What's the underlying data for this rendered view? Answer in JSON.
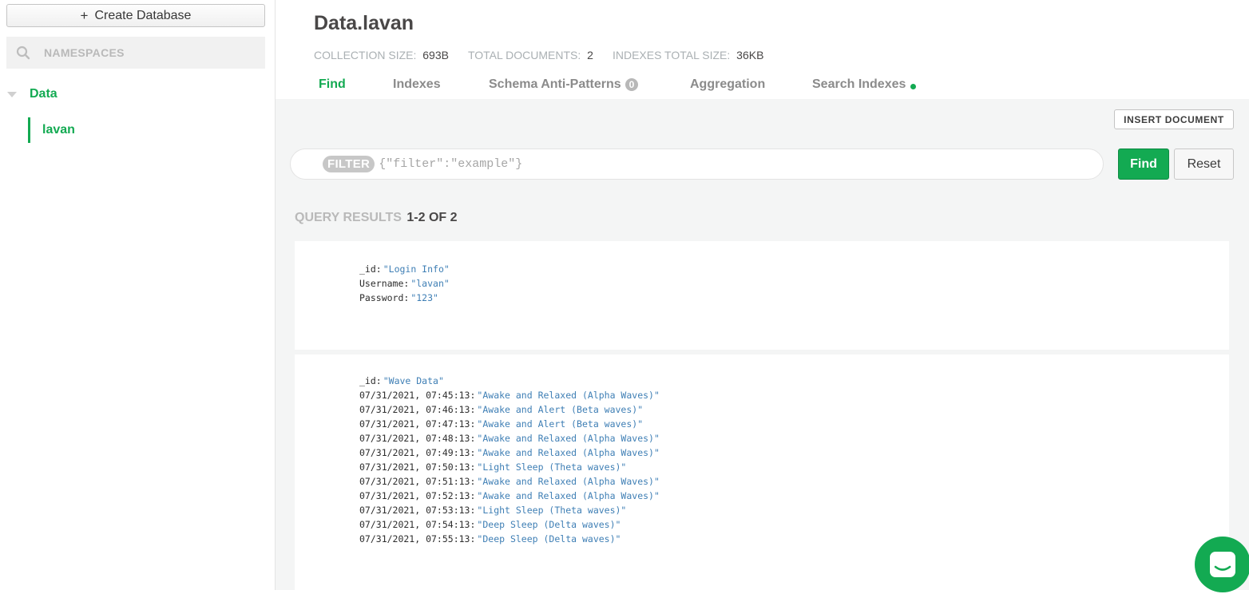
{
  "sidebar": {
    "create_database_label": "Create Database",
    "namespace_search_placeholder": "NAMESPACES",
    "database_name": "Data",
    "collection_name": "lavan"
  },
  "header": {
    "title": "Data.lavan",
    "stats": {
      "collection_size_label": "COLLECTION SIZE:",
      "collection_size_value": "693B",
      "total_documents_label": "TOTAL DOCUMENTS:",
      "total_documents_value": "2",
      "indexes_size_label": "INDEXES TOTAL SIZE:",
      "indexes_size_value": "36KB"
    },
    "tabs": {
      "find": "Find",
      "indexes": "Indexes",
      "schema": "Schema Anti-Patterns",
      "schema_count": "0",
      "aggregation": "Aggregation",
      "search_indexes": "Search Indexes"
    },
    "colors": {
      "accent": "#13aa52"
    }
  },
  "toolbar": {
    "insert_document_label": "INSERT DOCUMENT",
    "filter_label": "FILTER",
    "filter_placeholder": "{\"filter\":\"example\"}",
    "find_label": "Find",
    "reset_label": "Reset"
  },
  "results": {
    "label": "QUERY RESULTS",
    "range": "1-2 OF 2"
  },
  "documents": [
    {
      "fields": [
        {
          "key": "_id",
          "value": "\"Login Info\""
        },
        {
          "key": "Username",
          "value": "\"lavan\""
        },
        {
          "key": "Password",
          "value": "\"123\""
        }
      ]
    },
    {
      "fields": [
        {
          "key": "_id",
          "value": "\"Wave Data\""
        },
        {
          "key": "07/31/2021, 07:45:13",
          "value": "\"Awake and Relaxed (Alpha Waves)\""
        },
        {
          "key": "07/31/2021, 07:46:13",
          "value": "\"Awake and Alert (Beta waves)\""
        },
        {
          "key": "07/31/2021, 07:47:13",
          "value": "\"Awake and Alert (Beta waves)\""
        },
        {
          "key": "07/31/2021, 07:48:13",
          "value": "\"Awake and Relaxed (Alpha Waves)\""
        },
        {
          "key": "07/31/2021, 07:49:13",
          "value": "\"Awake and Relaxed (Alpha Waves)\""
        },
        {
          "key": "07/31/2021, 07:50:13",
          "value": "\"Light Sleep (Theta waves)\""
        },
        {
          "key": "07/31/2021, 07:51:13",
          "value": "\"Awake and Relaxed (Alpha Waves)\""
        },
        {
          "key": "07/31/2021, 07:52:13",
          "value": "\"Awake and Relaxed (Alpha Waves)\""
        },
        {
          "key": "07/31/2021, 07:53:13",
          "value": "\"Light Sleep (Theta waves)\""
        },
        {
          "key": "07/31/2021, 07:54:13",
          "value": "\"Deep Sleep (Delta waves)\""
        },
        {
          "key": "07/31/2021, 07:55:13",
          "value": "\"Deep Sleep (Delta waves)\""
        }
      ]
    }
  ]
}
